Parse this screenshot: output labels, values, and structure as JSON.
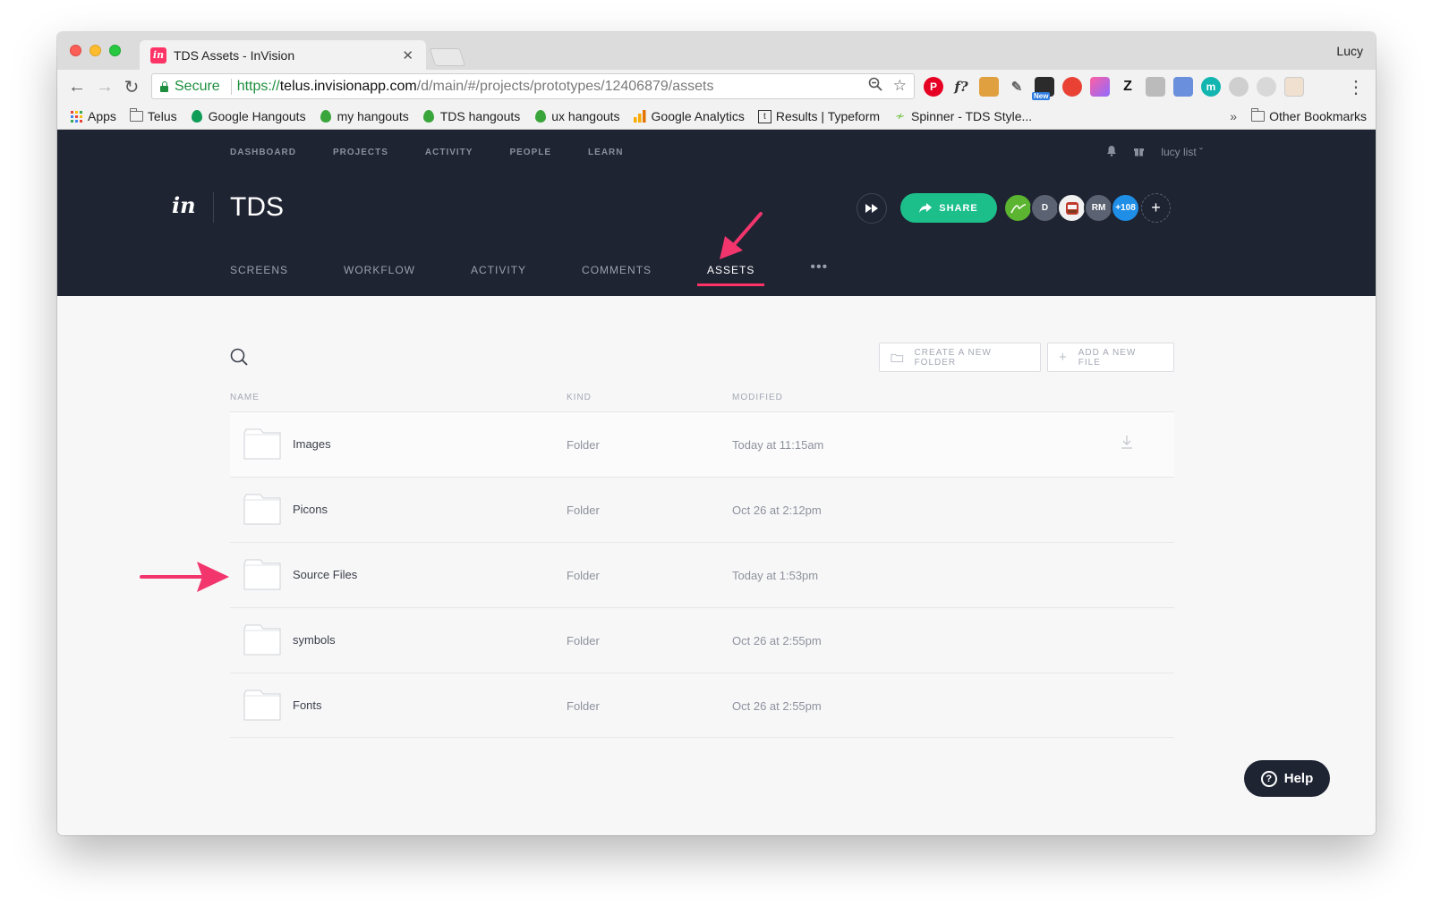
{
  "browser": {
    "tab_title": "TDS Assets - InVision",
    "tab_favicon": "in",
    "profile_name": "Lucy",
    "secure_label": "Secure",
    "url_scheme": "https://",
    "url_host": "telus.invisionapp.com",
    "url_path": "/d/main/#/projects/prototypes/12406879/assets",
    "extension_badge": "New",
    "bookmarks": [
      {
        "label": "Apps",
        "icon": "apps-grid-icon"
      },
      {
        "label": "Telus",
        "icon": "folder-icon"
      },
      {
        "label": "Google Hangouts",
        "icon": "hangouts-icon"
      },
      {
        "label": "my hangouts",
        "icon": "hangouts-icon"
      },
      {
        "label": "TDS hangouts",
        "icon": "hangouts-icon"
      },
      {
        "label": "ux hangouts",
        "icon": "hangouts-icon"
      },
      {
        "label": "Google Analytics",
        "icon": "analytics-icon"
      },
      {
        "label": "Results | Typeform",
        "icon": "typeform-icon"
      },
      {
        "label": "Spinner - TDS Style...",
        "icon": "spinner-icon"
      }
    ],
    "bookmarks_overflow": "»",
    "other_bookmarks": "Other Bookmarks"
  },
  "app": {
    "topnav": [
      "DASHBOARD",
      "PROJECTS",
      "ACTIVITY",
      "PEOPLE",
      "LEARN"
    ],
    "user_name": "lucy list",
    "logo": "in",
    "project_title": "TDS",
    "share_label": "SHARE",
    "avatars": [
      {
        "label": "",
        "color": "#5cb531"
      },
      {
        "label": "D",
        "color": "#5b6272"
      },
      {
        "label": "",
        "color": "#f1f1f1"
      },
      {
        "label": "RM",
        "color": "#5b6272"
      },
      {
        "label": "+108",
        "color": "#1f8ee6"
      }
    ],
    "add_member": "+",
    "subnav": [
      "SCREENS",
      "WORKFLOW",
      "ACTIVITY",
      "COMMENTS",
      "ASSETS"
    ],
    "subnav_active": "ASSETS",
    "subnav_more": "•••",
    "accent": "#ff3366"
  },
  "assets": {
    "create_folder_label": "CREATE A NEW FOLDER",
    "add_file_label": "ADD A NEW FILE",
    "columns": {
      "name": "NAME",
      "kind": "KIND",
      "modified": "MODIFIED"
    },
    "rows": [
      {
        "name": "Images",
        "kind": "Folder",
        "modified": "Today at 11:15am"
      },
      {
        "name": "Picons",
        "kind": "Folder",
        "modified": "Oct 26 at 2:12pm"
      },
      {
        "name": "Source Files",
        "kind": "Folder",
        "modified": "Today at 1:53pm"
      },
      {
        "name": "symbols",
        "kind": "Folder",
        "modified": "Oct 26 at 2:55pm"
      },
      {
        "name": "Fonts",
        "kind": "Folder",
        "modified": "Oct 26 at 2:55pm"
      }
    ],
    "help_label": "Help"
  }
}
